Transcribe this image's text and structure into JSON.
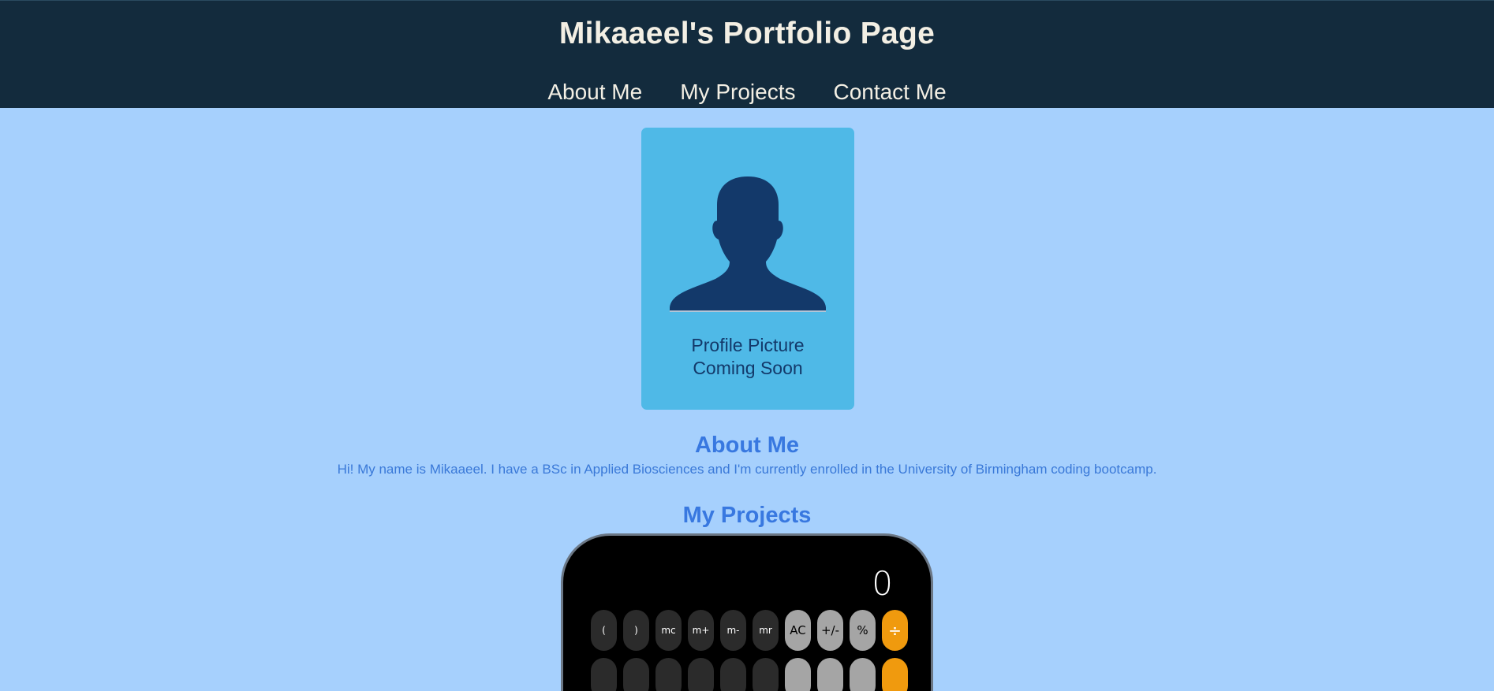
{
  "header": {
    "title": "Mikaaeel's Portfolio Page",
    "nav": [
      "About Me",
      "My Projects",
      "Contact Me"
    ]
  },
  "profile": {
    "caption_line1": "Profile Picture",
    "caption_line2": "Coming Soon"
  },
  "about": {
    "heading": "About Me",
    "text": "Hi! My name is Mikaaeel. I have a BSc in Applied Biosciences and I'm currently enrolled in the University of Birmingham coding bootcamp."
  },
  "projects": {
    "heading": "My Projects",
    "calculator": {
      "display": "0",
      "row1": [
        "(",
        ")",
        "mc",
        "m+",
        "m-",
        "mr",
        "AC",
        "+/-",
        "%",
        "÷"
      ]
    }
  },
  "colors": {
    "header_bg": "#132b3d",
    "page_bg": "#a6d0fd",
    "accent": "#3878e0",
    "card_bg": "#4fb9e7",
    "silhouette": "#13396a",
    "calc_orange": "#f09a0e"
  }
}
